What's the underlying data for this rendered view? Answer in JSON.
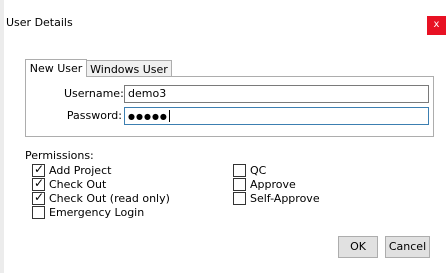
{
  "dialog": {
    "title": "User Details",
    "close_label": "x"
  },
  "tabs": [
    {
      "label": "New User",
      "selected": true
    },
    {
      "label": "Windows User",
      "selected": false
    }
  ],
  "fields": {
    "username": {
      "label": "Username:",
      "value": "demo3"
    },
    "password": {
      "label": "Password:",
      "value": "●●●●●"
    }
  },
  "permissions": {
    "label": "Permissions:",
    "items": [
      {
        "label": "Add Project",
        "checked": true
      },
      {
        "label": "Check Out",
        "checked": true
      },
      {
        "label": "Check Out (read only)",
        "checked": true
      },
      {
        "label": "Emergency Login",
        "checked": false
      },
      {
        "label": "QC",
        "checked": false
      },
      {
        "label": "Approve",
        "checked": false
      },
      {
        "label": "Self-Approve",
        "checked": false
      }
    ]
  },
  "buttons": {
    "ok": "OK",
    "cancel": "Cancel"
  },
  "colors": {
    "close_bg": "#e81123",
    "focus_border": "#3c7fb1"
  }
}
